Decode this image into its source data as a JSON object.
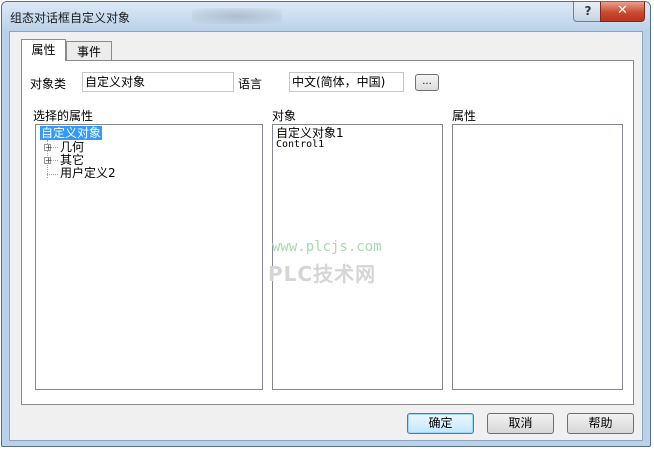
{
  "window": {
    "title": "组态对话框自定义对象",
    "help_label": "?",
    "close_label": "✕"
  },
  "tabs": [
    {
      "label": "属性",
      "active": true
    },
    {
      "label": "事件",
      "active": false
    }
  ],
  "form": {
    "class_label": "对象类",
    "class_value": "自定义对象",
    "language_label": "语言",
    "language_value": "中文(简体，中国)",
    "browse_label": "..."
  },
  "panes": {
    "selected_properties_label": "选择的属性",
    "objects_label": "对象",
    "properties_label": "属性"
  },
  "tree": {
    "root": "自定义对象",
    "children": [
      {
        "label": "几何",
        "expander": "+"
      },
      {
        "label": "其它",
        "expander": "+"
      },
      {
        "label": "用户定义2",
        "expander": ""
      }
    ]
  },
  "objects": [
    "自定义对象1",
    "Control1"
  ],
  "watermark": {
    "url": "www.plcjs.com",
    "brand": "PLC技术网"
  },
  "buttons": {
    "ok": "确定",
    "cancel": "取消",
    "help": "帮助"
  },
  "colors": {
    "selection": "#3399ff",
    "window_frame": "#b9d1ea",
    "close_button": "#c94a2f"
  },
  "icons": [
    "help-icon",
    "close-icon",
    "plus-expander-icon"
  ]
}
